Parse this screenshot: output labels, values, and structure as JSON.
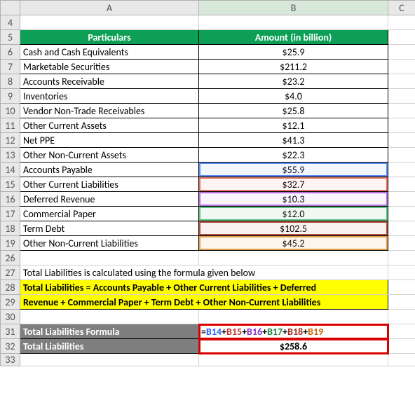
{
  "columns": {
    "A": "A",
    "B": "B",
    "C": "C"
  },
  "rows": [
    "4",
    "5",
    "6",
    "7",
    "8",
    "9",
    "10",
    "11",
    "12",
    "13",
    "14",
    "15",
    "16",
    "17",
    "18",
    "19",
    "26",
    "27",
    "28",
    "29",
    "30",
    "31",
    "32",
    "33"
  ],
  "header": {
    "particulars": "Particulars",
    "amount": "Amount (in billion)"
  },
  "items": [
    {
      "label": "Cash and Cash Equivalents",
      "value": "$25.9"
    },
    {
      "label": "Marketable Securities",
      "value": "$211.2"
    },
    {
      "label": "Accounts Receivable",
      "value": "$23.2"
    },
    {
      "label": "Inventories",
      "value": "$4.0"
    },
    {
      "label": "Vendor Non-Trade Receivables",
      "value": "$25.8"
    },
    {
      "label": "Other Current Assets",
      "value": "$12.1"
    },
    {
      "label": "Net PPE",
      "value": "$41.3"
    },
    {
      "label": "Other Non-Current Assets",
      "value": "$22.3"
    },
    {
      "label": "Accounts Payable",
      "value": "$55.9"
    },
    {
      "label": "Other Current Liabilities",
      "value": "$32.7"
    },
    {
      "label": "Deferred Revenue",
      "value": "$10.3"
    },
    {
      "label": "Commercial Paper",
      "value": "$12.0"
    },
    {
      "label": "Term Debt",
      "value": "$102.5"
    },
    {
      "label": "Other Non-Current Liabilities",
      "value": "$45.2"
    }
  ],
  "note": "Total Liabilities is calculated using the formula given below",
  "formula_text": {
    "l1": "Total Liabilities = Accounts Payable + Other Current Liabilities + Deferred",
    "l2": "Revenue + Commercial Paper + Term Debt + Other Non-Current Liabilities"
  },
  "result": {
    "formula_label": "Total Liabilities Formula",
    "total_label": "Total Liabilities",
    "total_value": "$258.6"
  },
  "formula_tokens": {
    "eq": "=",
    "p": "+",
    "b14": "B14",
    "b15": "B15",
    "b16": "B16",
    "b17": "B17",
    "b18": "B18",
    "b19": "B19"
  },
  "chart_data": {
    "type": "table",
    "title": "Amount (in billion)",
    "categories": [
      "Cash and Cash Equivalents",
      "Marketable Securities",
      "Accounts Receivable",
      "Inventories",
      "Vendor Non-Trade Receivables",
      "Other Current Assets",
      "Net PPE",
      "Other Non-Current Assets",
      "Accounts Payable",
      "Other Current Liabilities",
      "Deferred Revenue",
      "Commercial Paper",
      "Term Debt",
      "Other Non-Current Liabilities"
    ],
    "values": [
      25.9,
      211.2,
      23.2,
      4.0,
      25.8,
      12.1,
      41.3,
      22.3,
      55.9,
      32.7,
      10.3,
      12.0,
      102.5,
      45.2
    ],
    "derived": {
      "Total Liabilities": 258.6
    }
  }
}
